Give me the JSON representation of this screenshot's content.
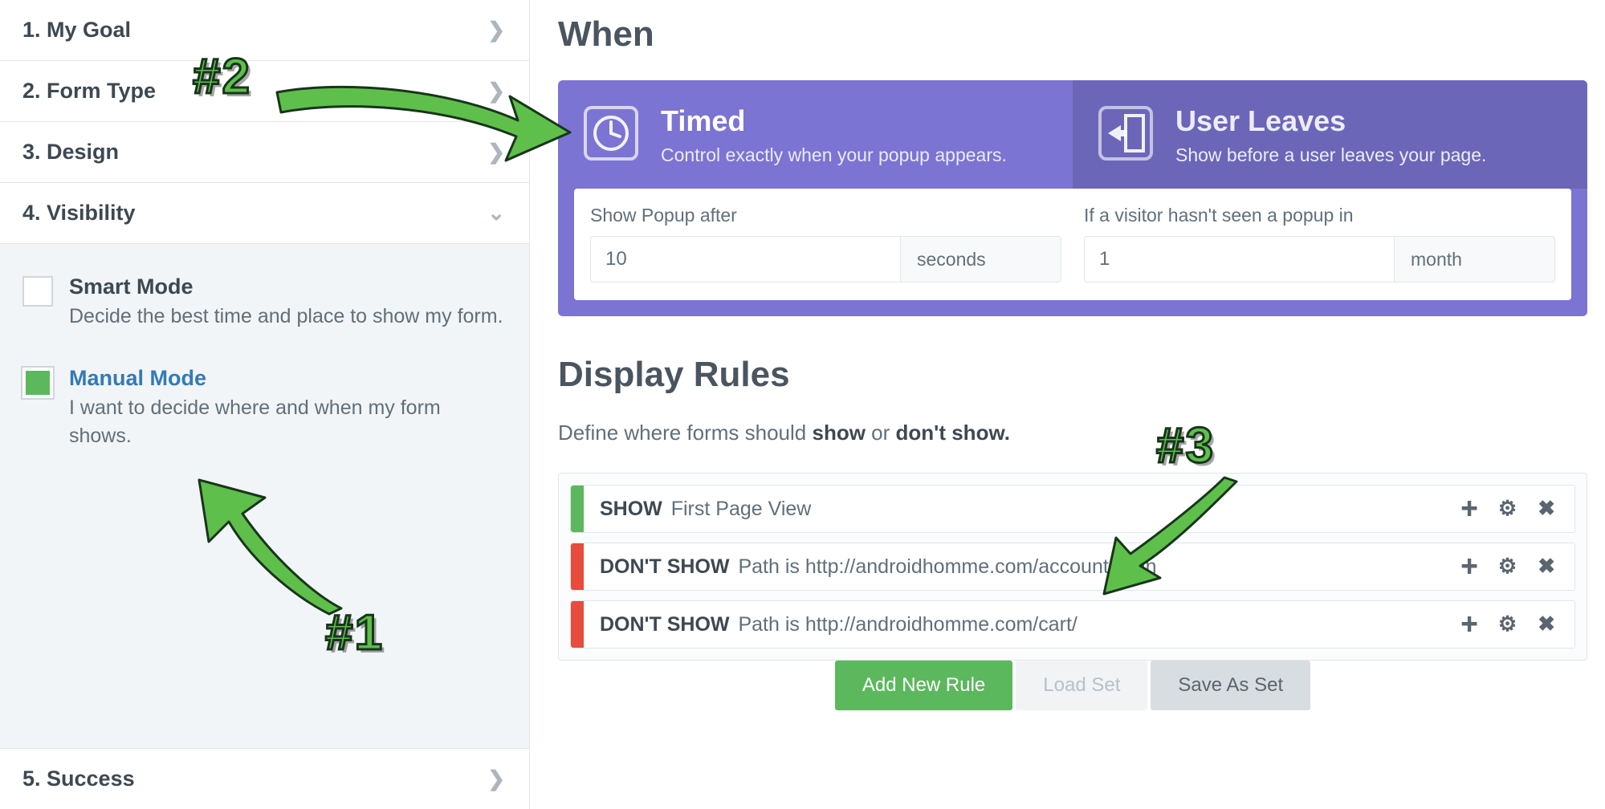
{
  "sidebar": {
    "items": [
      {
        "label": "1. My Goal",
        "expanded": false
      },
      {
        "label": "2. Form Type",
        "expanded": false
      },
      {
        "label": "3. Design",
        "expanded": false
      },
      {
        "label": "4. Visibility",
        "expanded": true
      },
      {
        "label": "5. Success",
        "expanded": false
      }
    ],
    "modes": {
      "smart": {
        "title": "Smart Mode",
        "desc": "Decide the best time and place to show my form."
      },
      "manual": {
        "title": "Manual Mode",
        "desc": "I want to decide where and when my form shows."
      }
    }
  },
  "when": {
    "heading": "When",
    "tabs": {
      "timed": {
        "title": "Timed",
        "desc": "Control exactly when your popup appears."
      },
      "user_leaves": {
        "title": "User Leaves",
        "desc": "Show before a user leaves your page."
      }
    },
    "fields": {
      "show_after": {
        "label": "Show Popup after",
        "value": "10",
        "unit": "seconds"
      },
      "not_seen": {
        "label": "If a visitor hasn't seen a popup in",
        "value": "1",
        "unit": "month"
      }
    }
  },
  "display_rules": {
    "heading": "Display Rules",
    "subtitle_pre": "Define where forms should ",
    "subtitle_show": "show",
    "subtitle_mid": " or ",
    "subtitle_dont": "don't show.",
    "rules": [
      {
        "type": "show",
        "kw": "SHOW",
        "text": "First Page View"
      },
      {
        "type": "dont",
        "kw": "DON'T SHOW",
        "text": "Path is http://androidhomme.com/account/login"
      },
      {
        "type": "dont",
        "kw": "DON'T SHOW",
        "text": "Path is http://androidhomme.com/cart/"
      }
    ],
    "buttons": {
      "add": "Add New Rule",
      "load": "Load Set",
      "save": "Save As Set"
    }
  },
  "annotations": {
    "tag1": "#1",
    "tag2": "#2",
    "tag3": "#3"
  }
}
